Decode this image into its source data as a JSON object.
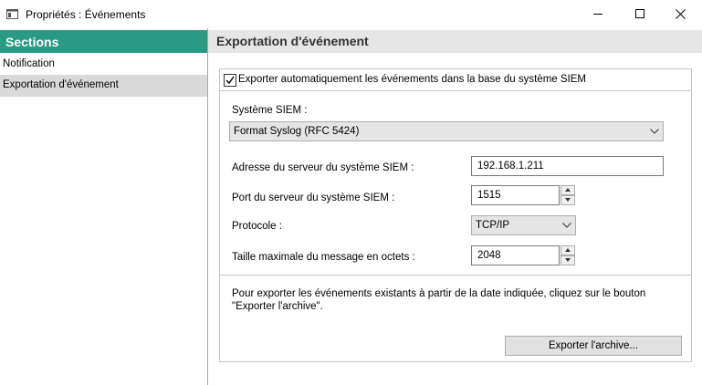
{
  "window": {
    "title": "Propriétés : Événements"
  },
  "sidebar": {
    "header": "Sections",
    "items": [
      {
        "label": "Notification"
      },
      {
        "label": "Exportation d'événement"
      }
    ]
  },
  "content": {
    "header": "Exportation d'événement",
    "export_checkbox": {
      "label": "Exporter automatiquement les événements dans la base du système SIEM",
      "checked": true
    },
    "siem_system": {
      "label": "Système SIEM :",
      "value": "Format Syslog (RFC 5424)"
    },
    "server_address": {
      "label": "Adresse du serveur du système SIEM :",
      "value": "192.168.1.211"
    },
    "server_port": {
      "label": "Port du serveur du système SIEM :",
      "value": "1515"
    },
    "protocol": {
      "label": "Protocole :",
      "value": "TCP/IP"
    },
    "max_message_size": {
      "label": "Taille maximale du message en octets :",
      "value": "2048"
    },
    "info_text": "Pour exporter les événements existants à partir de la date indiquée, cliquez sur le bouton \"Exporter l'archive\".",
    "export_archive_button": "Exporter l'archive..."
  },
  "colors": {
    "sidebar_header": "#2a9a85",
    "selected_item": "#d9d9d9",
    "content_header": "#e6e6e6"
  }
}
